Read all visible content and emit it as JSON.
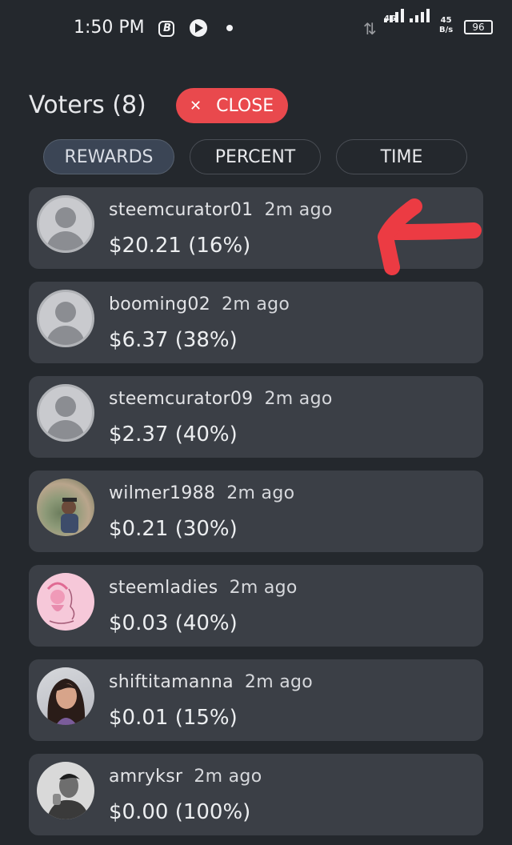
{
  "status_bar": {
    "time": "1:50 PM",
    "network": "4G",
    "speed_value": "45",
    "speed_unit": "B/s",
    "battery": "96"
  },
  "header": {
    "title": "Voters (8)",
    "close_label": "CLOSE"
  },
  "tabs": [
    {
      "label": "REWARDS",
      "active": true
    },
    {
      "label": "PERCENT",
      "active": false
    },
    {
      "label": "TIME",
      "active": false
    }
  ],
  "voters": [
    {
      "name": "steemcurator01",
      "time": "2m ago",
      "amount": "$20.21 (16%)",
      "avatar": "default-avatar-icon"
    },
    {
      "name": "booming02",
      "time": "2m ago",
      "amount": "$6.37 (38%)",
      "avatar": "default-avatar-icon"
    },
    {
      "name": "steemcurator09",
      "time": "2m ago",
      "amount": "$2.37 (40%)",
      "avatar": "default-avatar-icon"
    },
    {
      "name": "wilmer1988",
      "time": "2m ago",
      "amount": "$0.21 (30%)",
      "avatar": "photo"
    },
    {
      "name": "steemladies",
      "time": "2m ago",
      "amount": "$0.03 (40%)",
      "avatar": "photo"
    },
    {
      "name": "shiftitamanna",
      "time": "2m ago",
      "amount": "$0.01 (15%)",
      "avatar": "photo"
    },
    {
      "name": "amryksr",
      "time": "2m ago",
      "amount": "$0.00 (100%)",
      "avatar": "photo"
    }
  ],
  "colors": {
    "background": "#24282d",
    "card": "#3b3f46",
    "close_button": "#e9494d",
    "active_tab": "#3b4555",
    "annotation_arrow": "#ec3b43"
  }
}
